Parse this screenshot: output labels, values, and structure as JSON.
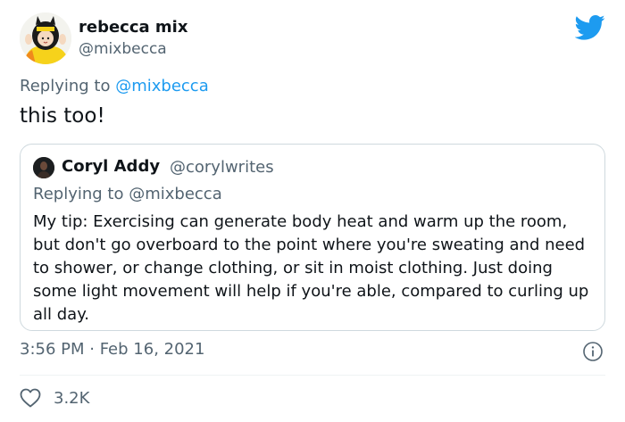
{
  "author": {
    "display_name": "rebecca mix",
    "handle": "@mixbecca"
  },
  "replying_to": {
    "prefix": "Replying to",
    "handle": "@mixbecca"
  },
  "tweet_text": "this too!",
  "quoted_tweet": {
    "display_name": "Coryl Addy",
    "handle": "@corylwrites",
    "replying_prefix": "Replying to",
    "replying_handle": "@mixbecca",
    "text": "My tip: Exercising can generate body heat and warm up the room, but don't go overboard to the point where you're sweating and need to shower, or change clothing, or sit in moist clothing. Just doing some light movement will help if you're able, compared to curling up all day."
  },
  "timestamp": "3:56 PM · Feb 16, 2021",
  "likes": "3.2K",
  "colors": {
    "accent": "#1d9bf0",
    "secondary_text": "#536471",
    "border": "#cfd9de"
  },
  "icons": {
    "brand": "twitter-bird-icon",
    "info": "info-icon",
    "like": "heart-icon"
  }
}
